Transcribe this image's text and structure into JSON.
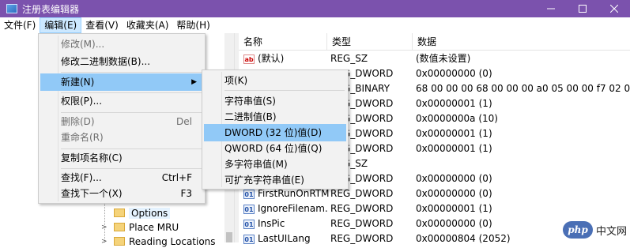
{
  "window": {
    "title": "注册表编辑器"
  },
  "menubar": {
    "items": [
      "文件(F)",
      "编辑(E)",
      "查看(V)",
      "收藏夹(A)",
      "帮助(H)"
    ]
  },
  "tree": {
    "items": [
      {
        "label": "Options",
        "selected": true
      },
      {
        "label": "Place MRU",
        "selected": false
      },
      {
        "label": "Reading Locations",
        "selected": false
      }
    ]
  },
  "list": {
    "headers": {
      "name": "名称",
      "type": "类型",
      "data": "数据"
    },
    "rows": [
      {
        "name": "(默认)",
        "type": "REG_SZ",
        "data": "(数值未设置)",
        "icon": "string-value-icon"
      },
      {
        "name": "",
        "type": "REG_DWORD",
        "data": "0x00000000 (0)",
        "icon": ""
      },
      {
        "name": "",
        "type": "REG_BINARY",
        "data": "68 00 00 00 68 00 00 00 a0 05 00 00 f7 02 00...",
        "icon": ""
      },
      {
        "name": "",
        "type": "REG_DWORD",
        "data": "0x00000001 (1)",
        "icon": ""
      },
      {
        "name": "",
        "type": "REG_DWORD",
        "data": "0x0000000a (10)",
        "icon": ""
      },
      {
        "name": "",
        "type": "REG_DWORD",
        "data": "0x00000001 (1)",
        "icon": ""
      },
      {
        "name": "",
        "type": "REG_DWORD",
        "data": "0x00000001 (1)",
        "icon": ""
      },
      {
        "name": "",
        "type": "REG_SZ",
        "data": "",
        "icon": ""
      },
      {
        "name": "",
        "type": "REG_DWORD",
        "data": "0x00000000 (0)",
        "icon": ""
      },
      {
        "name": "FirstRunOnRTM",
        "type": "REG_DWORD",
        "data": "0x00000000 (0)",
        "icon": "binary-value-icon"
      },
      {
        "name": "IgnoreFilenam...",
        "type": "REG_DWORD",
        "data": "0x00000001 (1)",
        "icon": "binary-value-icon"
      },
      {
        "name": "InsPic",
        "type": "REG_DWORD",
        "data": "0x00000000 (0)",
        "icon": "binary-value-icon"
      },
      {
        "name": "LastUILang",
        "type": "REG_DWORD",
        "data": "0x00000804 (2052)",
        "icon": "binary-value-icon"
      }
    ]
  },
  "edit_menu": {
    "items": [
      {
        "label": "修改(M)...",
        "shortcut": "",
        "disabled": false
      },
      {
        "label": "修改二进制数据(B)...",
        "shortcut": "",
        "disabled": false
      },
      {
        "label": "新建(N)",
        "shortcut": "",
        "disabled": false,
        "submenu": true
      },
      {
        "label": "权限(P)...",
        "shortcut": "",
        "disabled": false
      },
      {
        "label": "删除(D)",
        "shortcut": "Del",
        "disabled": true
      },
      {
        "label": "重命名(R)",
        "shortcut": "",
        "disabled": true
      },
      {
        "label": "复制项名称(C)",
        "shortcut": "",
        "disabled": false
      },
      {
        "label": "查找(F)...",
        "shortcut": "Ctrl+F",
        "disabled": false
      },
      {
        "label": "查找下一个(X)",
        "shortcut": "F3",
        "disabled": false
      }
    ]
  },
  "new_submenu": {
    "items": [
      "项(K)",
      "字符串值(S)",
      "二进制值(B)",
      "DWORD (32 位)值(D)",
      "QWORD (64 位)值(Q)",
      "多字符串值(M)",
      "可扩充字符串值(E)"
    ],
    "highlighted_index": 3
  },
  "watermark": {
    "logo_text": "php",
    "text": "中文网"
  },
  "colors": {
    "titlebar": "#7b52ad",
    "highlight": "#91c9f7",
    "menu_bg": "#f2f2f2"
  }
}
